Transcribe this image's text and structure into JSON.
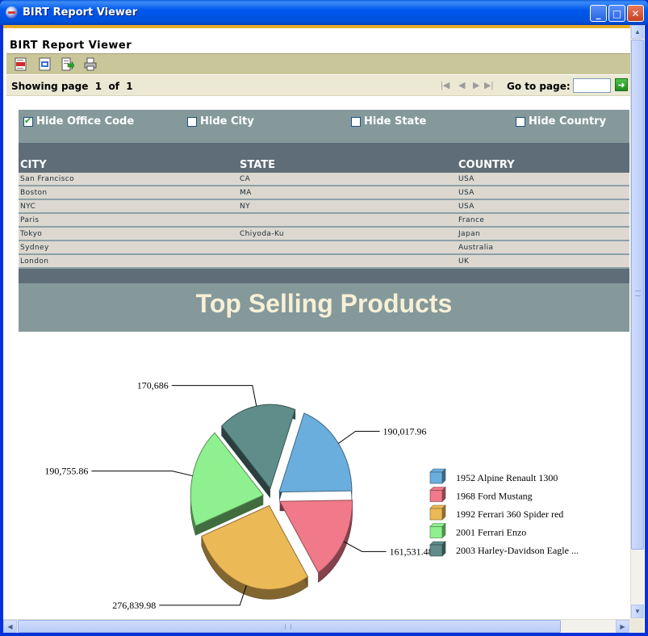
{
  "window": {
    "title": "BIRT Report Viewer",
    "minimize_glyph": "_",
    "maximize_glyph": "□",
    "close_glyph": "✕"
  },
  "viewer": {
    "title": "BIRT Report Viewer",
    "toolbar": {
      "icons": [
        "toc-icon",
        "parameters-icon",
        "export-icon",
        "print-icon"
      ]
    },
    "nav": {
      "showing_label": "Showing page",
      "current_page": "1",
      "of_label": "of",
      "total_pages": "1",
      "goto_label": "Go to page:",
      "goto_value": ""
    }
  },
  "filters": [
    {
      "label": "Hide Office Code",
      "checked": true
    },
    {
      "label": "Hide City",
      "checked": false
    },
    {
      "label": "Hide State",
      "checked": false
    },
    {
      "label": "Hide Country",
      "checked": false
    }
  ],
  "table": {
    "columns": [
      "CITY",
      "STATE",
      "COUNTRY"
    ],
    "rows": [
      [
        "San Francisco",
        "CA",
        "USA"
      ],
      [
        "Boston",
        "MA",
        "USA"
      ],
      [
        "NYC",
        "NY",
        "USA"
      ],
      [
        "Paris",
        "",
        "France"
      ],
      [
        "Tokyo",
        "Chiyoda-Ku",
        "Japan"
      ],
      [
        "Sydney",
        "",
        "Australia"
      ],
      [
        "London",
        "",
        "UK"
      ]
    ]
  },
  "banner": {
    "title": "Top Selling Products"
  },
  "chart_data": {
    "type": "pie",
    "title": "",
    "legend_position": "right",
    "slices": [
      {
        "label": "1952 Alpine Renault 1300",
        "value": 190017.96,
        "display": "190,017.96",
        "color": "#6aaedd"
      },
      {
        "label": "1968 Ford Mustang",
        "value": 161531.48,
        "display": "161,531.48",
        "color": "#f07a8a"
      },
      {
        "label": "1992 Ferrari 360 Spider red",
        "value": 276839.98,
        "display": "276,839.98",
        "color": "#ecb957"
      },
      {
        "label": "2001 Ferrari Enzo",
        "value": 190755.86,
        "display": "190,755.86",
        "color": "#8ef08e"
      },
      {
        "label": "2003 Harley-Davidson Eagle ...",
        "value": 170686,
        "display": "170,686",
        "color": "#5f8d8a"
      }
    ]
  }
}
